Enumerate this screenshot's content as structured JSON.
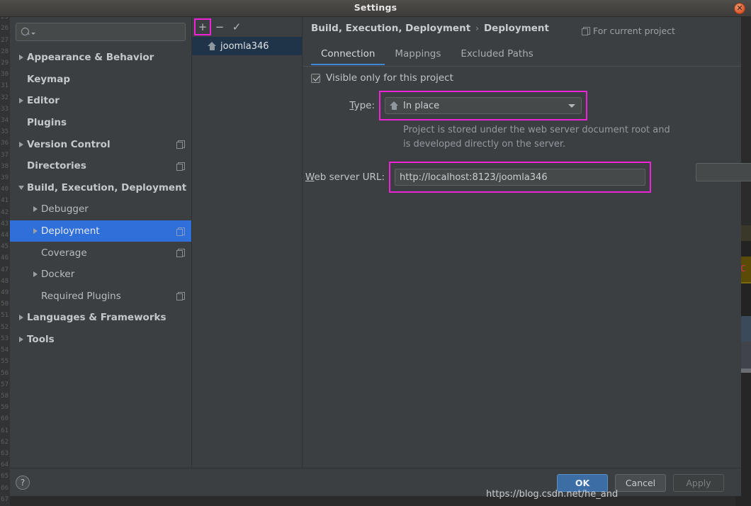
{
  "window": {
    "title": "Settings",
    "close_icon": "close-icon"
  },
  "search": {
    "value": "",
    "placeholder": "",
    "icon": "search-icon"
  },
  "sidebar": {
    "items": [
      {
        "label": "Appearance & Behavior",
        "indent": 0,
        "twisty": "collapsed",
        "bold": true,
        "project_icon": false,
        "selected": false
      },
      {
        "label": "Keymap",
        "indent": 0,
        "twisty": "none",
        "bold": true,
        "project_icon": false,
        "selected": false
      },
      {
        "label": "Editor",
        "indent": 0,
        "twisty": "collapsed",
        "bold": true,
        "project_icon": false,
        "selected": false
      },
      {
        "label": "Plugins",
        "indent": 0,
        "twisty": "none",
        "bold": true,
        "project_icon": false,
        "selected": false
      },
      {
        "label": "Version Control",
        "indent": 0,
        "twisty": "collapsed",
        "bold": true,
        "project_icon": true,
        "selected": false
      },
      {
        "label": "Directories",
        "indent": 0,
        "twisty": "none",
        "bold": true,
        "project_icon": true,
        "selected": false
      },
      {
        "label": "Build, Execution, Deployment",
        "indent": 0,
        "twisty": "expanded",
        "bold": true,
        "project_icon": false,
        "selected": false
      },
      {
        "label": "Debugger",
        "indent": 1,
        "twisty": "collapsed",
        "bold": false,
        "project_icon": false,
        "selected": false
      },
      {
        "label": "Deployment",
        "indent": 1,
        "twisty": "collapsed",
        "bold": false,
        "project_icon": true,
        "selected": true
      },
      {
        "label": "Coverage",
        "indent": 1,
        "twisty": "none",
        "bold": false,
        "project_icon": true,
        "selected": false
      },
      {
        "label": "Docker",
        "indent": 1,
        "twisty": "collapsed",
        "bold": false,
        "project_icon": false,
        "selected": false
      },
      {
        "label": "Required Plugins",
        "indent": 1,
        "twisty": "none",
        "bold": false,
        "project_icon": true,
        "selected": false
      },
      {
        "label": "Languages & Frameworks",
        "indent": 0,
        "twisty": "collapsed",
        "bold": true,
        "project_icon": false,
        "selected": false
      },
      {
        "label": "Tools",
        "indent": 0,
        "twisty": "collapsed",
        "bold": true,
        "project_icon": false,
        "selected": false
      }
    ]
  },
  "servers": {
    "toolbar": [
      {
        "name": "add-server-button",
        "glyph": "+",
        "highlighted": true
      },
      {
        "name": "remove-server-button",
        "glyph": "−",
        "highlighted": false
      },
      {
        "name": "set-default-button",
        "glyph": "✓",
        "highlighted": false
      }
    ],
    "items": [
      {
        "label": "joomla346",
        "icon": "home-icon",
        "selected": true
      }
    ]
  },
  "header": {
    "breadcrumb": [
      "Build, Execution, Deployment",
      "Deployment"
    ],
    "separator": "›",
    "for_project_label": "For current project",
    "for_project_icon": "project-scope-icon"
  },
  "tabs": [
    {
      "label": "Connection",
      "active": true
    },
    {
      "label": "Mappings",
      "active": false
    },
    {
      "label": "Excluded Paths",
      "active": false
    }
  ],
  "form": {
    "visible_only_checkbox": {
      "label": "Visible only for this project",
      "checked": true
    },
    "type": {
      "label_prefix": "T",
      "label_rest": "ype:",
      "value": "In place",
      "icon": "home-icon",
      "dropdown_icon": "chevron-down-icon",
      "highlighted": true,
      "description_line1": "Project is stored under the web server document root and",
      "description_line2": "is developed directly on the server."
    },
    "web_server_url": {
      "label_prefix": "W",
      "label_rest": "eb server URL:",
      "value": "http://localhost:8123/joomla346",
      "placeholder": "",
      "open_icon": "globe-icon",
      "highlighted": true
    }
  },
  "footer": {
    "help_label": "?",
    "ok_label": "OK",
    "cancel_label": "Cancel",
    "apply_label": "Apply",
    "apply_disabled": true
  },
  "watermark": {
    "text": "https://blog.csdn.net/he_and"
  },
  "colors": {
    "dialog_bg": "#3c3f41",
    "selection_blue": "#2f6fd9",
    "list_selection": "#1f3349",
    "accent_tab": "#3f87d4",
    "highlight_magenta": "#ee23d8",
    "ok_button": "#3c6ea5",
    "close_button": "#d9582a"
  }
}
